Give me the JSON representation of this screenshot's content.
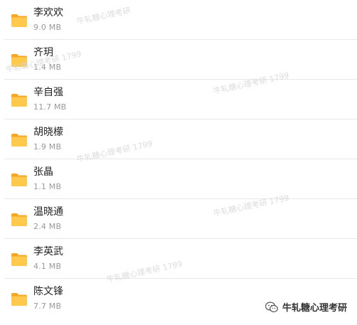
{
  "files": [
    {
      "name": "李欢欢",
      "size": "9.0 MB"
    },
    {
      "name": "齐玥",
      "size": "1.4 MB"
    },
    {
      "name": "辛自强",
      "size": "11.7 MB"
    },
    {
      "name": "胡晓檬",
      "size": "1.9 MB"
    },
    {
      "name": "张晶",
      "size": "1.1 MB"
    },
    {
      "name": "温晓通",
      "size": "2.4 MB"
    },
    {
      "name": "李英武",
      "size": "4.1 MB"
    },
    {
      "name": "陈文锋",
      "size": "7.7 MB"
    }
  ],
  "watermark": {
    "text_a": "牛轧糖心理考研 1799",
    "text_b": "牛轧糖心理考研"
  },
  "brand": {
    "label": "牛轧糖心理考研",
    "icon": "wechat-icon"
  },
  "colors": {
    "folder_back": "#F5A623",
    "folder_front": "#FFC94D",
    "separator": "#e8e8e8"
  }
}
